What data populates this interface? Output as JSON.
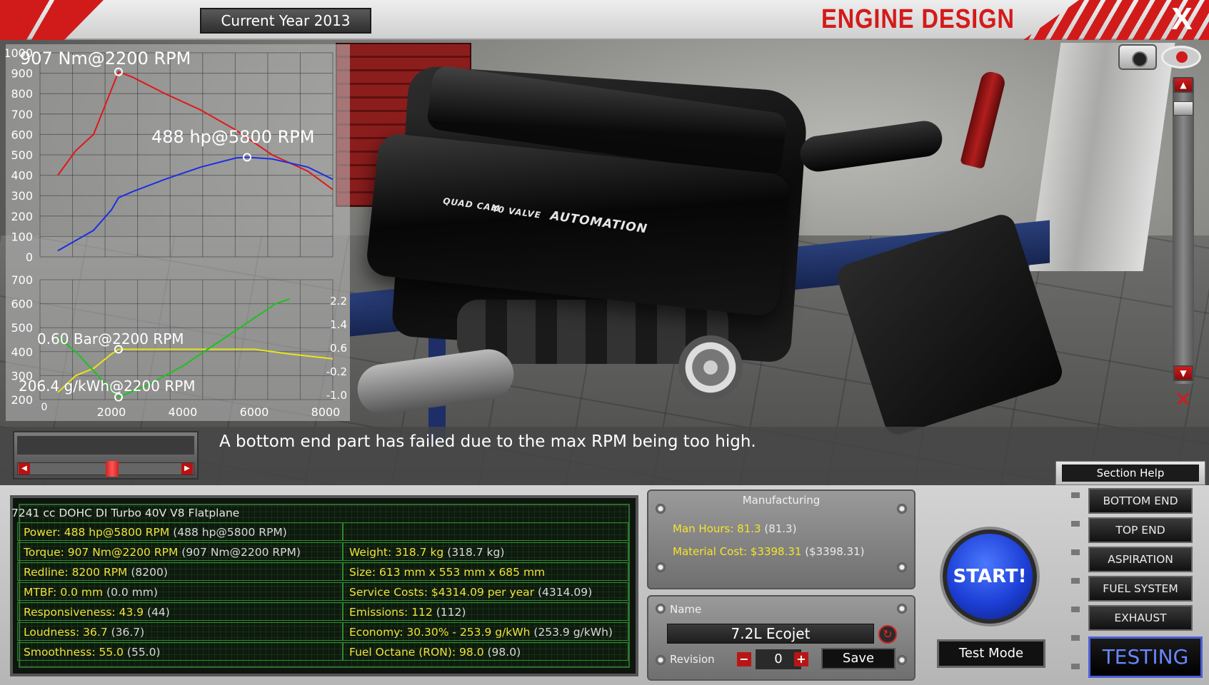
{
  "header": {
    "year_label": "Current Year 2013",
    "title": "ENGINE DESIGN",
    "close_label": "X"
  },
  "scene": {
    "cover_text_1": "QUAD CAM",
    "cover_text_2": "40 VALVE",
    "cover_brand": "AUTOMATION"
  },
  "charts": {
    "torque_annotation": "907 Nm@2200 RPM",
    "power_annotation": "488 hp@5800 RPM",
    "boost_annotation": "0.60 Bar@2200 RPM",
    "bsfc_annotation": "206.4 g/kWh@2200 RPM"
  },
  "chart_data": [
    {
      "type": "line",
      "title": "",
      "ylim": [
        0,
        1000
      ],
      "xlim": [
        0,
        8200
      ],
      "yticks": [
        "1000",
        "900",
        "800",
        "700",
        "600",
        "500",
        "400",
        "300",
        "200",
        "100",
        "0"
      ],
      "series": [
        {
          "color": "#e01818",
          "x": [
            500,
            1000,
            1500,
            2000,
            2200,
            2600,
            3500,
            4500,
            5500,
            6500,
            7500,
            8200
          ],
          "y": [
            400,
            520,
            600,
            820,
            907,
            880,
            800,
            720,
            620,
            500,
            420,
            330
          ]
        },
        {
          "color": "#1c2fe0",
          "x": [
            500,
            1000,
            1500,
            2000,
            2200,
            2600,
            3500,
            4500,
            5500,
            5800,
            6500,
            7500,
            8200
          ],
          "y": [
            30,
            80,
            130,
            230,
            290,
            320,
            380,
            440,
            485,
            488,
            480,
            440,
            380
          ]
        }
      ]
    },
    {
      "type": "line",
      "title": "",
      "ylim": [
        200,
        700
      ],
      "xlim": [
        0,
        8200
      ],
      "yticks": [
        "700",
        "600",
        "500",
        "400",
        "300",
        "200",
        "0"
      ],
      "y2ticks": [
        "2.2",
        "1.4",
        "0.6",
        "-0.2",
        "-1.0"
      ],
      "xticks": [
        "2000",
        "4000",
        "6000",
        "8000"
      ],
      "series": [
        {
          "color": "#e8e41a",
          "x": [
            500,
            1000,
            1500,
            2000,
            2200,
            3000,
            4000,
            5000,
            6000,
            7000,
            8200
          ],
          "y": [
            230,
            300,
            330,
            390,
            410,
            410,
            410,
            410,
            410,
            390,
            370
          ]
        },
        {
          "color": "#20c020",
          "x": [
            500,
            1000,
            1500,
            2000,
            2200,
            3000,
            4000,
            5000,
            6000,
            6600,
            7000
          ],
          "y": [
            460,
            400,
            320,
            240,
            210,
            260,
            340,
            440,
            540,
            600,
            620
          ]
        }
      ]
    }
  ],
  "scene_controls": {
    "camera_icon": "camera-icon",
    "eye_icon": "eye-icon",
    "hide_icon": "hide-icon",
    "scroll_up": "▲",
    "scroll_down": "▼"
  },
  "message": "A bottom end part has failed due to the max RPM being too high.",
  "section_help_label": "Section Help",
  "stats": {
    "description": "7241 cc DOHC DI Turbo 40V V8 Flatplane",
    "left": [
      {
        "key": "Power: 488 hp@5800 RPM",
        "val": " (488 hp@5800 RPM)"
      },
      {
        "key": "Torque: 907 Nm@2200 RPM",
        "val": " (907 Nm@2200 RPM)"
      },
      {
        "key": "Redline: 8200 RPM",
        "val": " (8200)"
      },
      {
        "key": "MTBF: 0.0 mm",
        "val": " (0.0 mm)"
      },
      {
        "key": "Responsiveness: 43.9",
        "val": " (44)"
      },
      {
        "key": "Loudness: 36.7",
        "val": " (36.7)"
      },
      {
        "key": "Smoothness: 55.0",
        "val": " (55.0)"
      }
    ],
    "right": [
      {
        "key": "Weight: 318.7 kg",
        "val": " (318.7 kg)"
      },
      {
        "key": "Size: 613 mm x 553 mm x 685 mm",
        "val": ""
      },
      {
        "key": "Service Costs: $4314.09 per year",
        "val": " (4314.09)"
      },
      {
        "key": "Emissions: 112",
        "val": " (112)"
      },
      {
        "key": "Economy: 30.30% - 253.9 g/kWh",
        "val": " (253.9 g/kWh)"
      },
      {
        "key": "Fuel Octane (RON): 98.0",
        "val": " (98.0)"
      }
    ]
  },
  "manufacturing": {
    "title": "Manufacturing",
    "man_hours_key": "Man Hours: 81.3",
    "man_hours_val": " (81.3)",
    "material_key": "Material Cost: $3398.31",
    "material_val": " ($3398.31)"
  },
  "naming": {
    "name_label": "Name",
    "name_value": "7.2L Ecojet",
    "revision_label": "Revision",
    "revision_value": "0",
    "minus": "−",
    "plus": "+",
    "save_label": "Save"
  },
  "actions": {
    "start_label": "START!",
    "test_mode_label": "Test Mode"
  },
  "sections": [
    "BOTTOM END",
    "TOP END",
    "ASPIRATION",
    "FUEL SYSTEM",
    "EXHAUST"
  ],
  "testing_label": "TESTING"
}
